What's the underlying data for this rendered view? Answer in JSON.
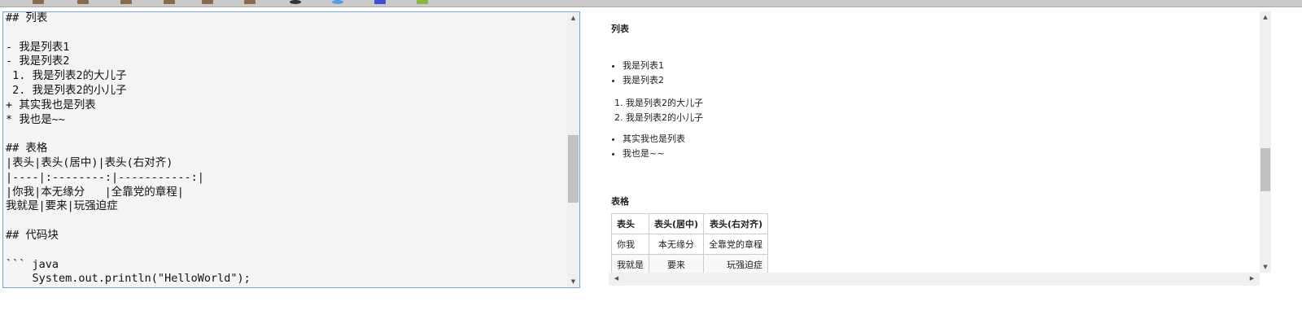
{
  "editor": {
    "lines": [
      "## 列表",
      "",
      "- 我是列表1",
      "- 我是列表2",
      " 1. 我是列表2的大儿子",
      " 2. 我是列表2的小儿子",
      "+ 其实我也是列表",
      "* 我也是~~",
      "",
      "## 表格",
      "|表头|表头(居中)|表头(右对齐)",
      "|----|:--------:|-----------:|",
      "|你我|本无缘分   |全靠党的章程|",
      "我就是|要来|玩强迫症",
      "",
      "## 代码块",
      "",
      "``` java",
      "    System.out.println(\"HelloWorld\");",
      "```"
    ]
  },
  "preview": {
    "list_heading": "列表",
    "ul1": [
      "我是列表1",
      "我是列表2"
    ],
    "ol": [
      "我是列表2的大儿子",
      "我是列表2的小儿子"
    ],
    "ul2": [
      "其实我也是列表",
      "我也是~~"
    ],
    "table_heading": "表格",
    "table": {
      "headers": [
        "表头",
        "表头(居中)",
        "表头(右对齐)"
      ],
      "rows": [
        [
          "你我",
          "本无缘分",
          "全靠党的章程"
        ],
        [
          "我就是",
          "要来",
          "玩强迫症"
        ]
      ]
    }
  }
}
